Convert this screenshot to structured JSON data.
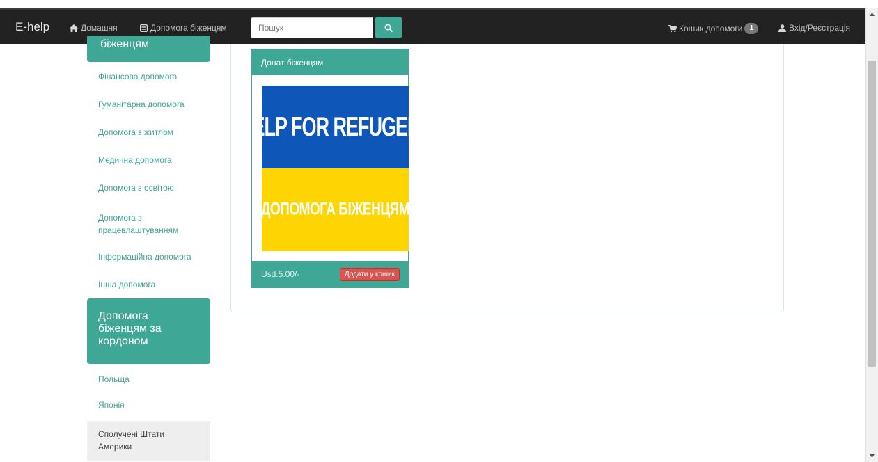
{
  "navbar": {
    "brand": "E-help",
    "home_label": "Домашня",
    "help_label": "Допомога біженцям",
    "search_placeholder": "Пошук",
    "cart_label": "Кошик допомоги",
    "cart_count": "1",
    "login_label": "Вхід/Реєстрація"
  },
  "sidebar": {
    "top_header": "біженцям",
    "items": [
      {
        "label": "Фінансова допомога"
      },
      {
        "label": "Гуманітарна допомога"
      },
      {
        "label": "Допомога з житлом"
      },
      {
        "label": "Медична допомога"
      },
      {
        "label": "Допомога з освітою"
      },
      {
        "label": "Допомога з працевлаштуванням"
      },
      {
        "label": "Інформаційна допомога"
      },
      {
        "label": "Інша допомога"
      }
    ],
    "abroad_header": "Допомога біженцям за кордоном",
    "abroad_items": [
      {
        "label": "Польща"
      },
      {
        "label": "Японія"
      },
      {
        "label": "Сполучені Штати Америки"
      }
    ]
  },
  "product": {
    "title": "Донат біженцям",
    "image_text_en": "HELP FOR REFUGEES",
    "image_text_ua": "ДОПОМОГА БІЖЕНЦЯМ",
    "price": "Usd.5.00/-",
    "add_to_cart_label": "Додати у кошик"
  },
  "colors": {
    "accent": "#3fa796",
    "navbar": "#222222",
    "danger": "#d9534f",
    "flag_blue": "#0e57b8",
    "flag_yellow": "#fed500"
  }
}
